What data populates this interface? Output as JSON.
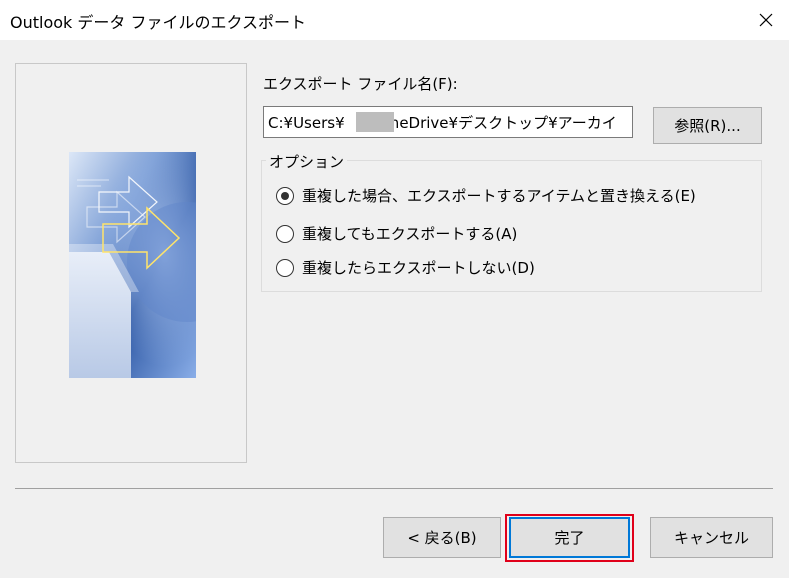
{
  "window": {
    "title": "Outlook データ ファイルのエクスポート",
    "close_icon": "close-icon"
  },
  "wizard_image": {
    "icon": "export-wizard-graphic"
  },
  "export_file": {
    "label": "エクスポート ファイル名(F):",
    "path_value": "C:¥Users¥     ¥OneDrive¥デスクトップ¥アーカイ",
    "browse_label": "参照(R)..."
  },
  "options": {
    "legend": "オプション",
    "items": [
      {
        "label": "重複した場合、エクスポートするアイテムと置き換える(E)",
        "selected": true
      },
      {
        "label": "重複してもエクスポートする(A)",
        "selected": false
      },
      {
        "label": "重複したらエクスポートしない(D)",
        "selected": false
      }
    ]
  },
  "footer": {
    "back_label": "< 戻る(B)",
    "finish_label": "完了",
    "cancel_label": "キャンセル"
  },
  "colors": {
    "highlight": "#e0001a",
    "focus_border": "#0078d7",
    "graphic_blue": "#3a64ad"
  }
}
